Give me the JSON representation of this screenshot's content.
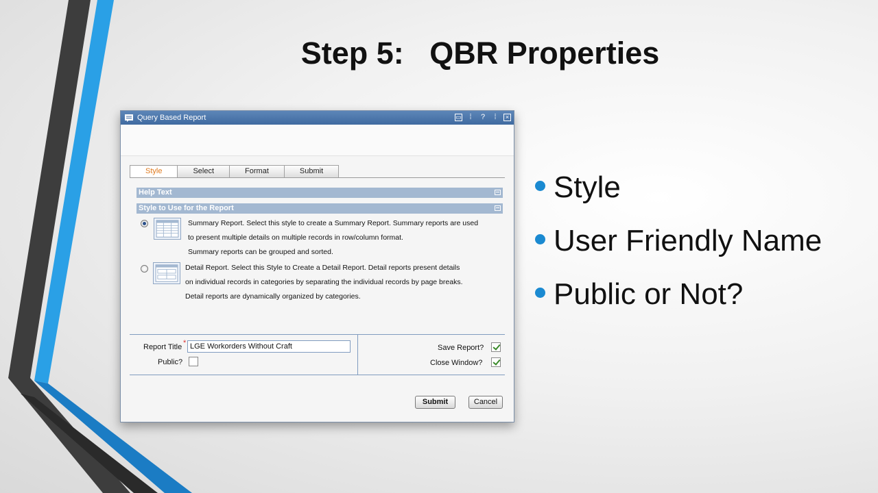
{
  "slide": {
    "title": "Step 5:   QBR Properties",
    "bullets": [
      "Style",
      "User Friendly Name",
      "Public or Not?"
    ],
    "accent_color": "#1b8ad1"
  },
  "window": {
    "title": "Query Based Report",
    "controls": {
      "restore": "restore-icon",
      "help": "?",
      "close": "close-icon"
    },
    "tabs": [
      {
        "label": "Style",
        "active": true
      },
      {
        "label": "Select",
        "active": false
      },
      {
        "label": "Format",
        "active": false
      },
      {
        "label": "Submit",
        "active": false
      }
    ],
    "help_section": "Help Text",
    "style_section": "Style to Use for the Report",
    "options": [
      {
        "selected": true,
        "lines": [
          "Summary Report. Select this style to create a Summary Report. Summary reports are used",
          "to present multiple details on multiple records in row/column format.",
          "Summary reports can be grouped and sorted."
        ]
      },
      {
        "selected": false,
        "lines": [
          "Detail Report. Select this Style to Create a Detail Report. Detail reports present details",
          "on individual records in categories by separating the individual records by page breaks.",
          "Detail reports are dynamically organized by categories."
        ]
      }
    ],
    "form": {
      "report_title_label": "Report Title",
      "required_marker": "*",
      "report_title_value": "LGE Workorders Without Craft",
      "public_label": "Public?",
      "public_checked": false,
      "save_label": "Save Report?",
      "save_checked": true,
      "close_label": "Close Window?",
      "close_checked": true
    },
    "buttons": {
      "submit": "Submit",
      "cancel": "Cancel"
    }
  }
}
